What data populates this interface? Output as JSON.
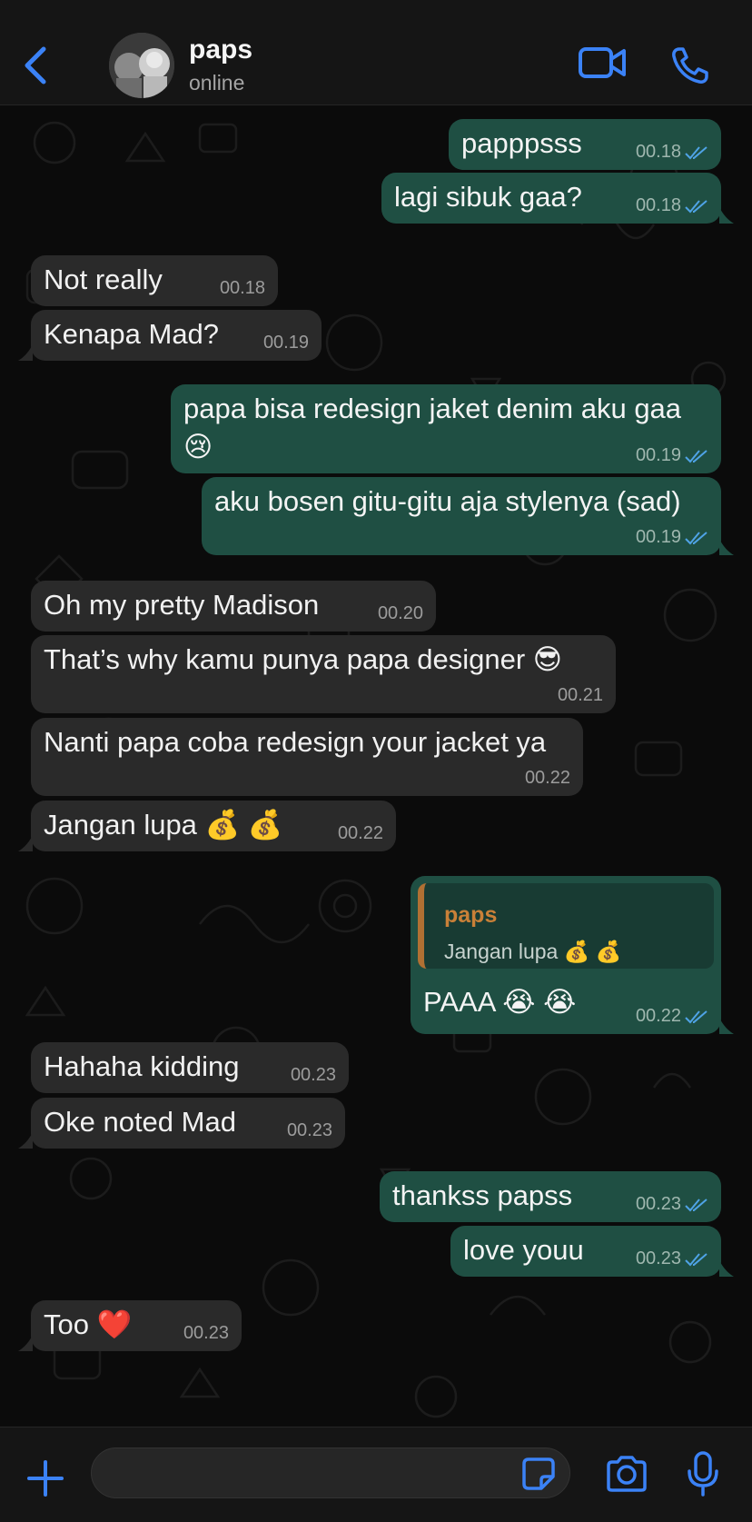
{
  "header": {
    "name": "paps",
    "status": "online",
    "back_icon": "chevron-left-icon",
    "video_icon": "video-camera-icon",
    "phone_icon": "phone-icon"
  },
  "colors": {
    "accent": "#3b82f6",
    "outgoing_bubble": "#1f4f43",
    "incoming_bubble": "#2a2a2a",
    "read_tick": "#4fa3e6",
    "quote_name": "#c98038"
  },
  "messages": [
    {
      "dir": "out",
      "text": "papppsss",
      "time": "00.18"
    },
    {
      "dir": "out",
      "text": "lagi sibuk gaa?",
      "time": "00.18"
    },
    {
      "dir": "in",
      "text": "Not really",
      "time": "00.18"
    },
    {
      "dir": "in",
      "text": "Kenapa Mad?",
      "time": "00.19"
    },
    {
      "dir": "out",
      "text": "papa bisa redesign jaket denim aku gaa",
      "emoji": "😢",
      "time": "00.19"
    },
    {
      "dir": "out",
      "text": "aku bosen gitu-gitu aja stylenya (sad)",
      "time": "00.19"
    },
    {
      "dir": "in",
      "text": "Oh my pretty Madison",
      "time": "00.20"
    },
    {
      "dir": "in",
      "text": "That’s why kamu punya papa designer 😎",
      "time": "00.21"
    },
    {
      "dir": "in",
      "text": "Nanti papa coba redesign your jacket ya",
      "time": "00.22"
    },
    {
      "dir": "in",
      "text": "Jangan lupa 💰 💰",
      "time": "00.22"
    },
    {
      "dir": "out",
      "text": "PAAA 😭 😭",
      "time": "00.22",
      "quote_name": "paps",
      "quote_text": "Jangan lupa 💰 💰"
    },
    {
      "dir": "in",
      "text": "Hahaha kidding",
      "time": "00.23"
    },
    {
      "dir": "in",
      "text": "Oke noted Mad",
      "time": "00.23"
    },
    {
      "dir": "out",
      "text": "thankss papss",
      "time": "00.23"
    },
    {
      "dir": "out",
      "text": "love youu",
      "time": "00.23"
    },
    {
      "dir": "in",
      "text": "Too ❤️",
      "time": "00.23"
    }
  ],
  "input": {
    "plus_icon": "plus-icon",
    "placeholder": "",
    "sticker_icon": "sticker-icon",
    "camera_icon": "camera-icon",
    "mic_icon": "microphone-icon"
  }
}
